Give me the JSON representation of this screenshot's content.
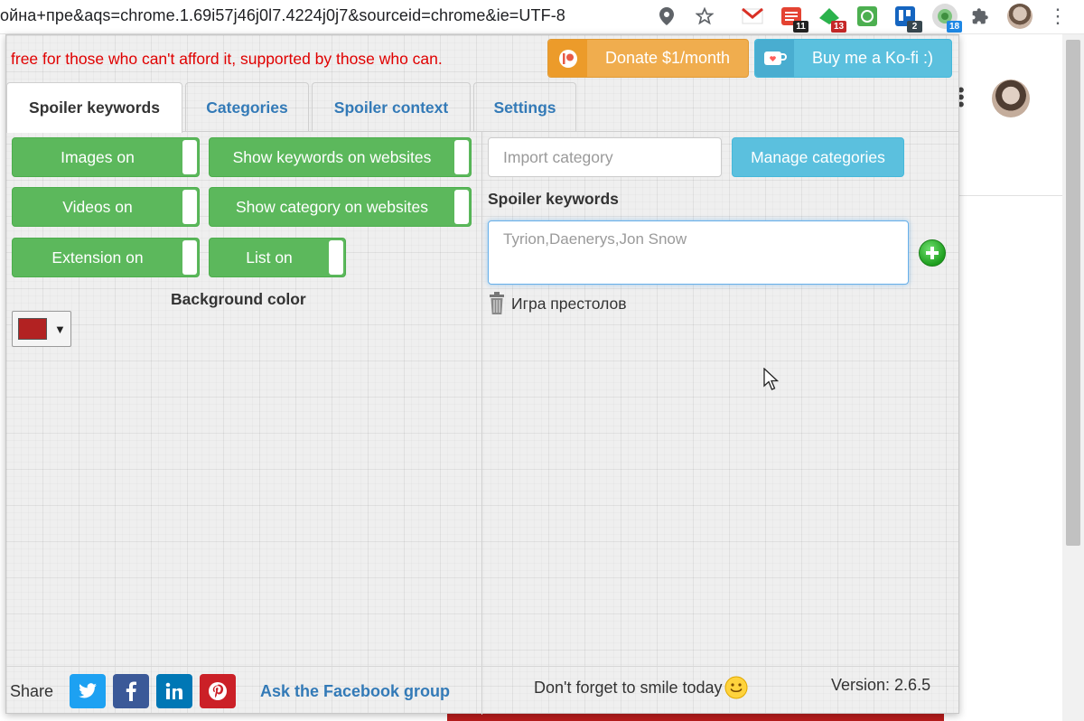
{
  "browser": {
    "url_fragment": "ойна+пре&aqs=chrome.1.69i57j46j0l7.4224j0j7&sourceid=chrome&ie=UTF-8",
    "extensions": [
      {
        "name": "gmail-icon",
        "badge": ""
      },
      {
        "name": "todoist-icon",
        "badge": "11"
      },
      {
        "name": "feedly-icon",
        "badge": "13"
      },
      {
        "name": "refresh-extension-icon",
        "badge": ""
      },
      {
        "name": "trello-icon",
        "badge": "2"
      },
      {
        "name": "spoiler-blocker-icon",
        "badge": "18"
      }
    ]
  },
  "popup": {
    "promo_text": "free for those who can't afford it, supported by those who can.",
    "donate_label": "Donate $1/month",
    "kofi_label": "Buy me a Ko-fi :)",
    "tabs": [
      {
        "label": "Spoiler keywords",
        "active": true
      },
      {
        "label": "Categories",
        "active": false
      },
      {
        "label": "Spoiler context",
        "active": false
      },
      {
        "label": "Settings",
        "active": false
      }
    ],
    "toggles": {
      "images": "Images on",
      "show_keywords": "Show keywords on websites",
      "videos": "Videos on",
      "show_category": "Show category on websites",
      "extension": "Extension on",
      "list": "List on"
    },
    "background_color_label": "Background color",
    "background_color_value": "#b22222",
    "import_placeholder": "Import category",
    "manage_categories_label": "Manage categories",
    "keywords_heading": "Spoiler keywords",
    "keywords_placeholder": "Tyrion,Daenerys,Jon Snow",
    "categories": [
      "Игра престолов"
    ],
    "footer": {
      "share_label": "Share",
      "fb_group_link": "Ask the Facebook group",
      "smile_text": "Don't forget to smile today",
      "version_text": "Version: 2.6.5"
    }
  },
  "colors": {
    "toggle_green": "#5cb85c",
    "info_blue": "#5bc0de",
    "donate_orange": "#f0ad4e",
    "link_blue": "#337ab7",
    "promo_red": "#e00000"
  }
}
